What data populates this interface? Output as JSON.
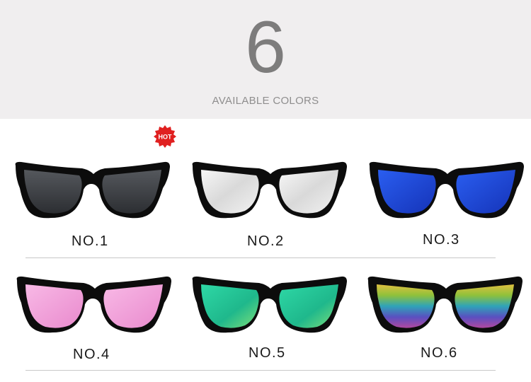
{
  "header": {
    "count": "6",
    "subtitle": "AVAILABLE COLORS"
  },
  "badge": {
    "text": "HOT",
    "color": "#e02020"
  },
  "products": [
    {
      "label": "NO.1",
      "lens": "smoke-grey",
      "lens_color": "#3a3d42"
    },
    {
      "label": "NO.2",
      "lens": "silver-mirror",
      "lens_color": "#e6e6e6"
    },
    {
      "label": "NO.3",
      "lens": "blue-mirror",
      "lens_color": "#1d47d6"
    },
    {
      "label": "NO.4",
      "lens": "pink-mirror",
      "lens_color": "#f2a3dd"
    },
    {
      "label": "NO.5",
      "lens": "green-mirror",
      "lens_color": "#22c59a"
    },
    {
      "label": "NO.6",
      "lens": "rainbow-mirror",
      "lens_color": "#7bbf3a"
    }
  ],
  "frame_color": "#0c0c0c"
}
